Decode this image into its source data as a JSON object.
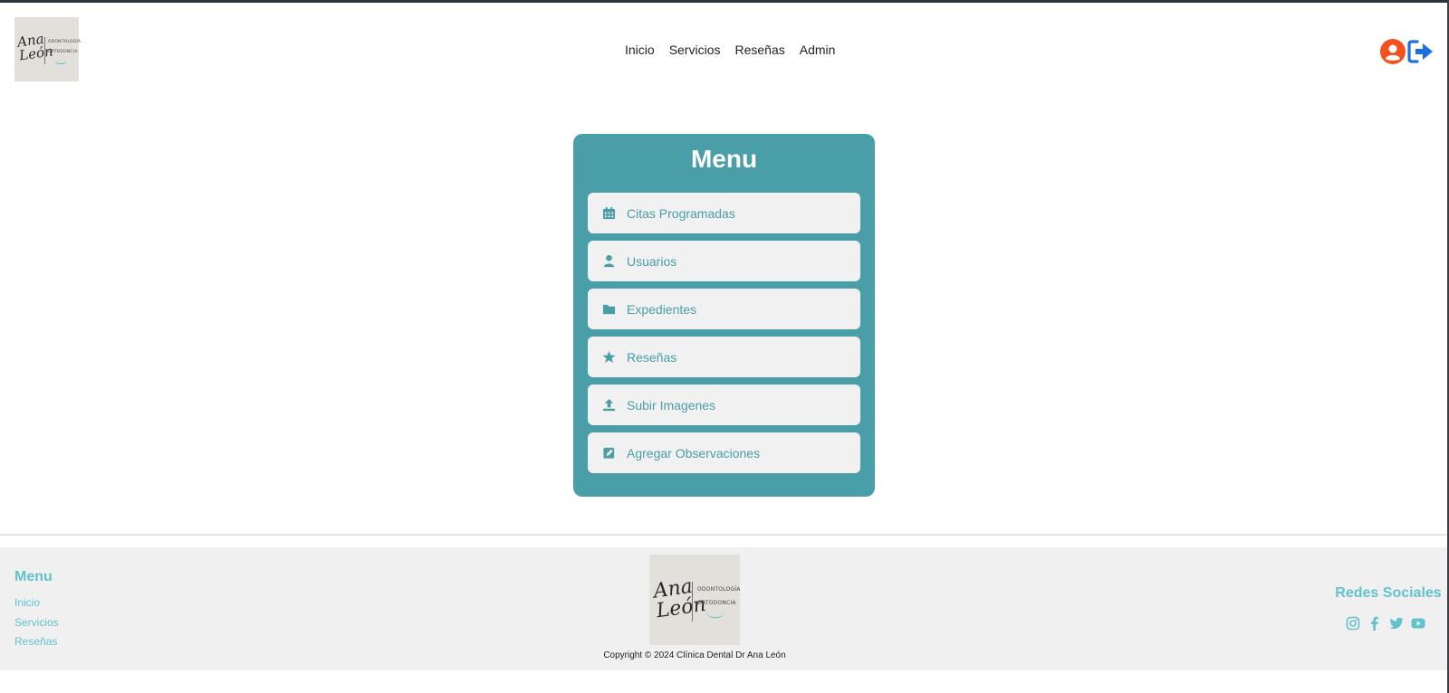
{
  "header": {
    "logo_alt": "Ana León Odontología Ortodoncia",
    "nav": [
      {
        "label": "Inicio"
      },
      {
        "label": "Servicios"
      },
      {
        "label": "Reseñas"
      },
      {
        "label": "Admin"
      }
    ]
  },
  "logo": {
    "signature": "Ana León",
    "line1": "ODONTOLOGÍA",
    "line2": "ORTODONCIA"
  },
  "menu": {
    "title": "Menu",
    "items": [
      {
        "label": "Citas Programadas",
        "icon": "calendar-icon"
      },
      {
        "label": "Usuarios",
        "icon": "user-icon"
      },
      {
        "label": "Expedientes",
        "icon": "folder-icon"
      },
      {
        "label": "Reseñas",
        "icon": "star-icon"
      },
      {
        "label": "Subir Imagenes",
        "icon": "upload-icon"
      },
      {
        "label": "Agregar Observaciones",
        "icon": "edit-icon"
      }
    ]
  },
  "footer": {
    "menu_title": "Menu",
    "links": [
      {
        "label": "Inicio"
      },
      {
        "label": "Servicios"
      },
      {
        "label": "Reseñas"
      }
    ],
    "copyright": "Copyright © 2024 Clínica Dental Dr Ana León",
    "social_title": "Redes Sociales",
    "social_icons": [
      "instagram-icon",
      "facebook-icon",
      "twitter-icon",
      "youtube-icon"
    ]
  },
  "colors": {
    "accent": "#4a9ea8",
    "footer_accent": "#62c3cd",
    "user_icon": "#f4511e",
    "logout_icon": "#1e6fe0",
    "footer_bg": "#f0f0f0"
  }
}
